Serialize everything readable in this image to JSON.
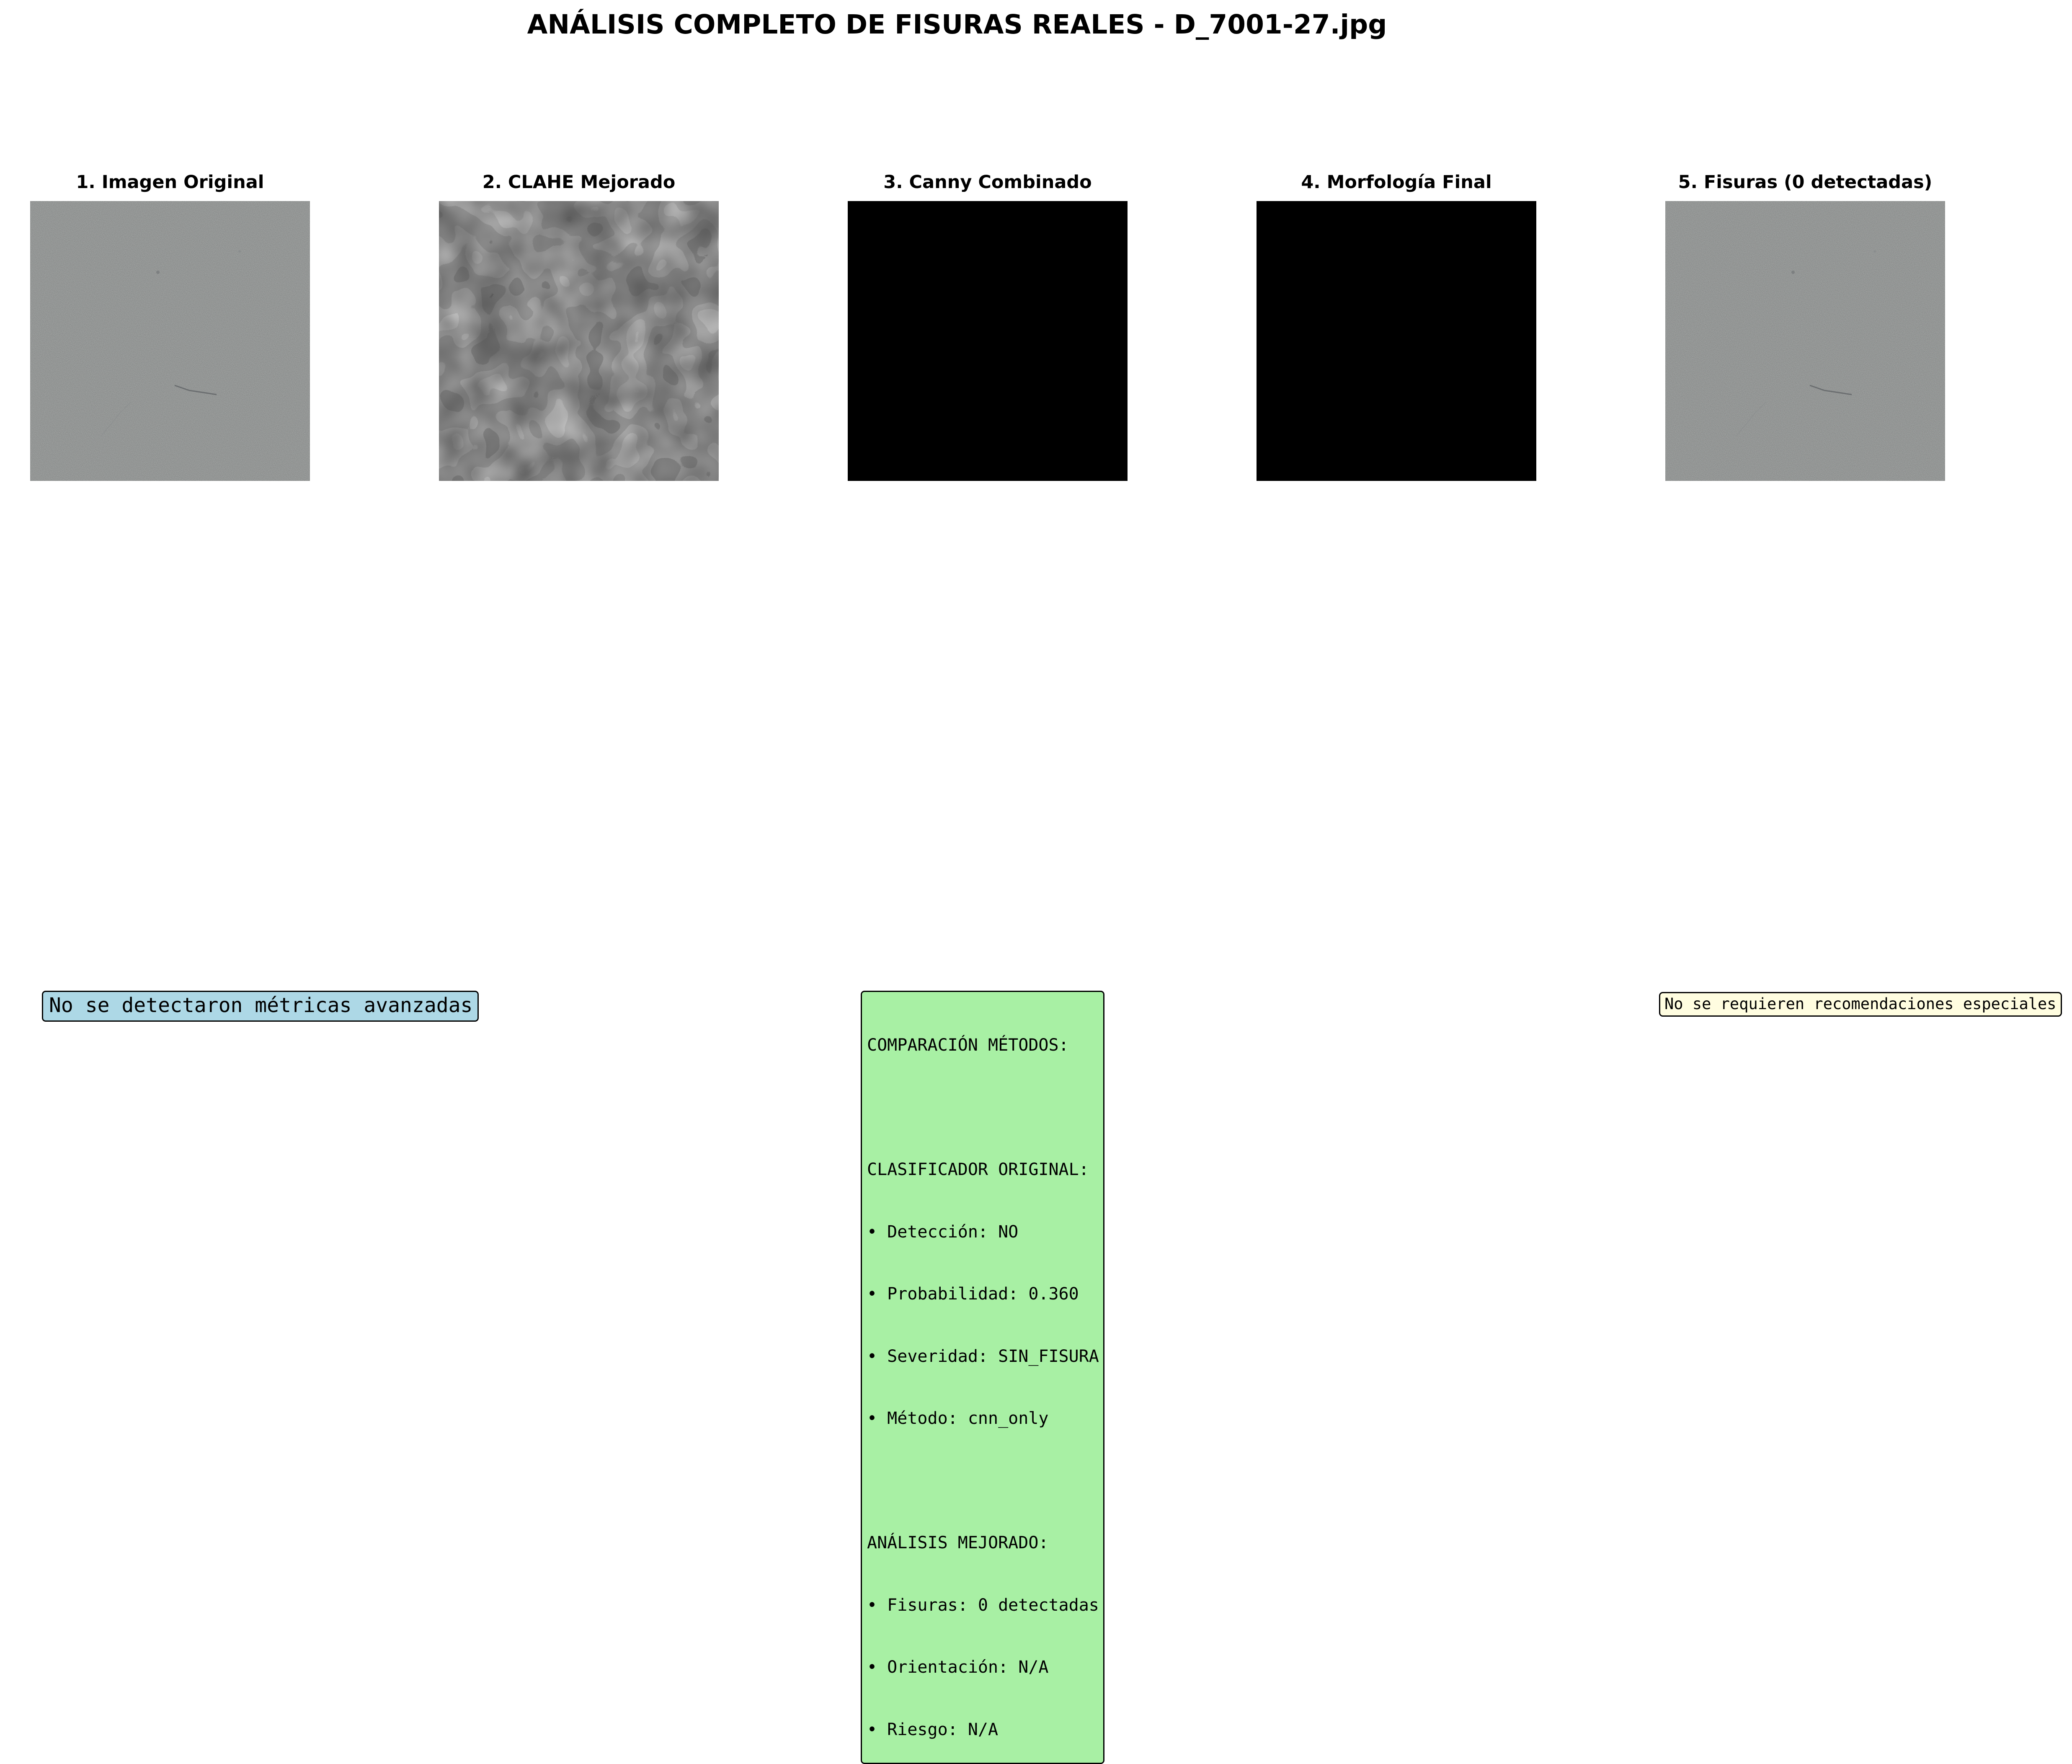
{
  "figure": {
    "title": "ANÁLISIS COMPLETO DE FISURAS REALES - D_7001-27.jpg"
  },
  "panels": [
    {
      "title": "1. Imagen Original",
      "content": "concrete surface photograph"
    },
    {
      "title": "2. CLAHE Mejorado",
      "content": "contrast enhanced grayscale texture"
    },
    {
      "title": "3. Canny Combinado",
      "content": "black edge map (no edges)"
    },
    {
      "title": "4. Morfología Final",
      "content": "black morphology map (empty)"
    },
    {
      "title": "5. Fisuras (0 detectadas)",
      "content": "concrete surface photograph"
    }
  ],
  "metrics_box": {
    "text": "No se detectaron métricas avanzadas",
    "color": "#add8e6"
  },
  "comparison_box": {
    "color": "#a8f0a4",
    "lines": [
      "COMPARACIÓN MÉTODOS:",
      "",
      "CLASIFICADOR ORIGINAL:",
      "• Detección: NO",
      "• Probabilidad: 0.360",
      "• Severidad: SIN_FISURA",
      "• Método: cnn_only",
      "",
      "ANÁLISIS MEJORADO:",
      "• Fisuras: 0 detectadas",
      "• Orientación: N/A",
      "• Riesgo: N/A"
    ]
  },
  "recommendations_box": {
    "text": "No se requieren recomendaciones especiales",
    "color": "#fffde0"
  }
}
